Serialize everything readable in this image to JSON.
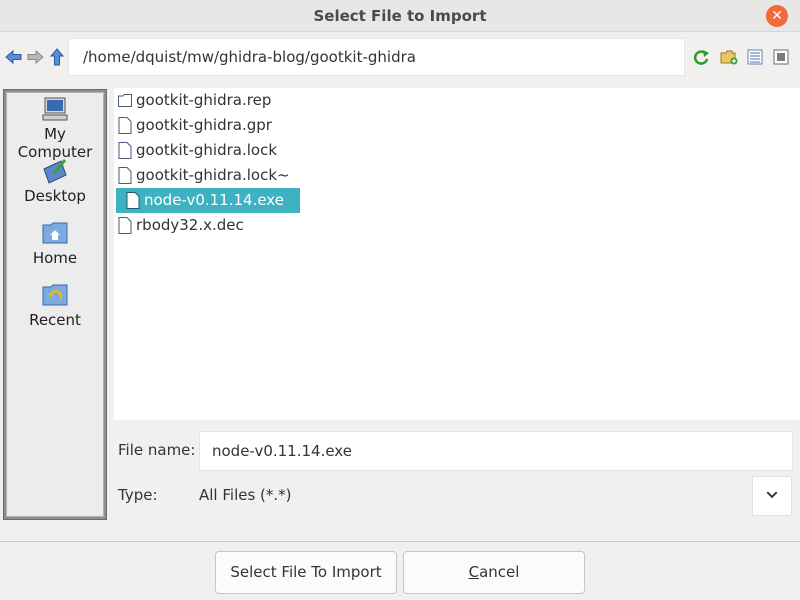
{
  "window": {
    "title": "Select File to Import",
    "close_glyph": "✕"
  },
  "toolbar": {
    "path": "/home/dquist/mw/ghidra-blog/gootkit-ghidra",
    "icons": [
      "back-arrow-icon",
      "forward-arrow-icon",
      "up-arrow-icon",
      "refresh-icon",
      "new-folder-icon",
      "list-view-icon",
      "details-view-icon"
    ]
  },
  "sidebar": {
    "items": [
      {
        "label": "My Computer",
        "icon": "computer-icon"
      },
      {
        "label": "Desktop",
        "icon": "desktop-icon"
      },
      {
        "label": "Home",
        "icon": "home-folder-icon"
      },
      {
        "label": "Recent",
        "icon": "recent-folder-icon"
      }
    ]
  },
  "files": [
    {
      "name": "gootkit-ghidra.rep",
      "kind": "folder",
      "selected": false
    },
    {
      "name": "gootkit-ghidra.gpr",
      "kind": "file",
      "selected": false
    },
    {
      "name": "gootkit-ghidra.lock",
      "kind": "file",
      "selected": false
    },
    {
      "name": "gootkit-ghidra.lock~",
      "kind": "file",
      "selected": false
    },
    {
      "name": "node-v0.11.14.exe",
      "kind": "file",
      "selected": true
    },
    {
      "name": "rbody32.x.dec",
      "kind": "file",
      "selected": false
    }
  ],
  "form": {
    "file_name_label": "File name:",
    "file_name_value": "node-v0.11.14.exe",
    "type_label": "Type:",
    "type_value": "All Files (*.*)"
  },
  "buttons": {
    "select_label": "Select File To Import",
    "cancel_first": "C",
    "cancel_rest": "ancel"
  },
  "colors": {
    "selection": "#3eb1c3",
    "close": "#f06a3c"
  }
}
